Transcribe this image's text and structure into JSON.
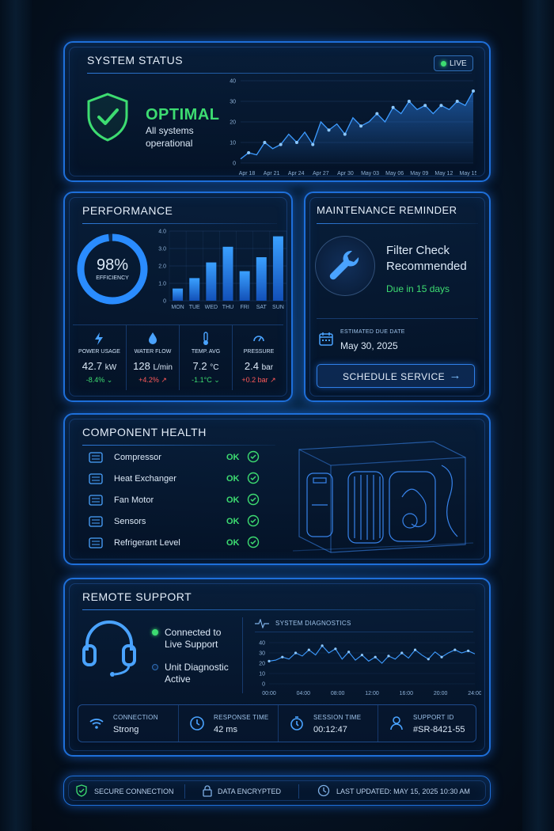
{
  "system_status": {
    "title": "SYSTEM STATUS",
    "live_label": "LIVE",
    "status": "OPTIMAL",
    "subtitle_line1": "All systems",
    "subtitle_line2": "operational"
  },
  "performance": {
    "title": "PERFORMANCE",
    "efficiency_value": "98%",
    "efficiency_label": "EFFICIENCY",
    "efficiency_fraction": 0.98,
    "metrics": [
      {
        "label": "POWER USAGE",
        "value": "42.7",
        "unit": "kW",
        "change": "-8.4%",
        "trend": "down",
        "icon": "lightning-icon"
      },
      {
        "label": "WATER FLOW",
        "value": "128",
        "unit": "L/min",
        "change": "+4.2%",
        "trend": "up",
        "icon": "water-drop-icon"
      },
      {
        "label": "TEMP. AVG",
        "value": "7.2",
        "unit": "°C",
        "change": "-1.1°C",
        "trend": "down",
        "icon": "thermometer-icon"
      },
      {
        "label": "PRESSURE",
        "value": "2.4",
        "unit": "bar",
        "change": "+0.2 bar",
        "trend": "up",
        "icon": "gauge-icon"
      }
    ]
  },
  "maintenance": {
    "title": "MAINTENANCE REMINDER",
    "headline_line1": "Filter Check",
    "headline_line2": "Recommended",
    "due_text": "Due in 15 days",
    "due_label": "ESTIMATED DUE DATE",
    "due_date": "May 30, 2025",
    "button_label": "SCHEDULE SERVICE"
  },
  "component_health": {
    "title": "COMPONENT HEALTH",
    "items": [
      {
        "name": "Compressor",
        "status": "OK",
        "icon": "compressor-icon"
      },
      {
        "name": "Heat Exchanger",
        "status": "OK",
        "icon": "heat-exchanger-icon"
      },
      {
        "name": "Fan Motor",
        "status": "OK",
        "icon": "fan-icon"
      },
      {
        "name": "Sensors",
        "status": "OK",
        "icon": "sensor-icon"
      },
      {
        "name": "Refrigerant Level",
        "status": "OK",
        "icon": "refrigerant-icon"
      }
    ]
  },
  "remote_support": {
    "title": "REMOTE SUPPORT",
    "status1_line1": "Connected to",
    "status1_line2": "Live Support",
    "status2_line1": "Unit Diagnostic",
    "status2_line2": "Active",
    "diagnostics_title": "SYSTEM DIAGNOSTICS",
    "stats": [
      {
        "label": "CONNECTION",
        "value": "Strong",
        "icon": "wifi-icon"
      },
      {
        "label": "RESPONSE TIME",
        "value": "42 ms",
        "icon": "clock-icon"
      },
      {
        "label": "SESSION TIME",
        "value": "00:12:47",
        "icon": "stopwatch-icon"
      },
      {
        "label": "SUPPORT ID",
        "value": "#SR-8421-55",
        "icon": "user-icon"
      }
    ]
  },
  "footer": {
    "secure": "SECURE CONNECTION",
    "encrypted": "DATA ENCRYPTED",
    "updated": "LAST UPDATED: MAY 15, 2025 10:30 AM"
  },
  "colors": {
    "accent": "#1e6fd9",
    "ok": "#3ddc71",
    "alert": "#ff5a5a"
  },
  "chart_data": [
    {
      "type": "area",
      "categories": [
        "Apr 18",
        "Apr 21",
        "Apr 24",
        "Apr 27",
        "Apr 30",
        "May 03",
        "May 06",
        "May 09",
        "May 12",
        "May 15"
      ],
      "ylim": [
        0,
        40
      ],
      "yticks": [
        0,
        10,
        20,
        30,
        40
      ],
      "values": [
        2,
        5,
        4,
        10,
        7,
        9,
        14,
        10,
        15,
        9,
        20,
        16,
        19,
        14,
        22,
        18,
        20,
        24,
        20,
        27,
        24,
        30,
        26,
        28,
        24,
        28,
        26,
        30,
        28,
        35
      ]
    },
    {
      "type": "bar",
      "categories": [
        "MON",
        "TUE",
        "WED",
        "THU",
        "FRI",
        "SAT",
        "SUN"
      ],
      "values": [
        0.7,
        1.3,
        2.2,
        3.1,
        1.7,
        2.5,
        3.7
      ],
      "ylim": [
        0,
        4.0
      ],
      "yticks": [
        "0",
        "1.0",
        "2.0",
        "3.0",
        "4.0"
      ]
    },
    {
      "type": "line",
      "categories": [
        "00:00",
        "04:00",
        "08:00",
        "12:00",
        "16:00",
        "20:00",
        "24:00"
      ],
      "ylim": [
        0,
        40
      ],
      "yticks": [
        0,
        10,
        20,
        30,
        40
      ],
      "values": [
        22,
        23,
        26,
        24,
        30,
        27,
        33,
        28,
        37,
        30,
        34,
        24,
        31,
        23,
        28,
        22,
        26,
        20,
        27,
        24,
        30,
        25,
        33,
        28,
        24,
        31,
        26,
        30,
        33,
        30,
        32,
        29
      ]
    }
  ]
}
